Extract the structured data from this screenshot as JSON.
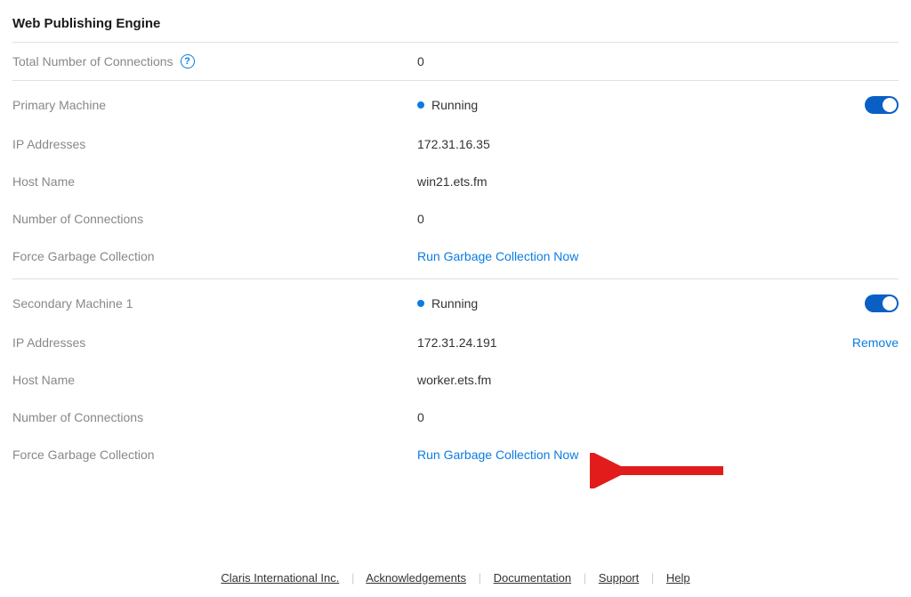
{
  "title": "Web Publishing Engine",
  "totalConnections": {
    "label": "Total Number of Connections",
    "value": "0"
  },
  "primary": {
    "machineLabel": "Primary Machine",
    "status": "Running",
    "ipLabel": "IP Addresses",
    "ipValue": "172.31.16.35",
    "hostLabel": "Host Name",
    "hostValue": "win21.ets.fm",
    "connLabel": "Number of Connections",
    "connValue": "0",
    "gcLabel": "Force Garbage Collection",
    "gcAction": "Run Garbage Collection Now"
  },
  "secondary": {
    "machineLabel": "Secondary Machine 1",
    "status": "Running",
    "ipLabel": "IP Addresses",
    "ipValue": "172.31.24.191",
    "removeLabel": "Remove",
    "hostLabel": "Host Name",
    "hostValue": "worker.ets.fm",
    "connLabel": "Number of Connections",
    "connValue": "0",
    "gcLabel": "Force Garbage Collection",
    "gcAction": "Run Garbage Collection Now"
  },
  "footer": {
    "company": "Claris International Inc.",
    "acknowledgements": "Acknowledgements",
    "documentation": "Documentation",
    "support": "Support",
    "help": "Help"
  }
}
